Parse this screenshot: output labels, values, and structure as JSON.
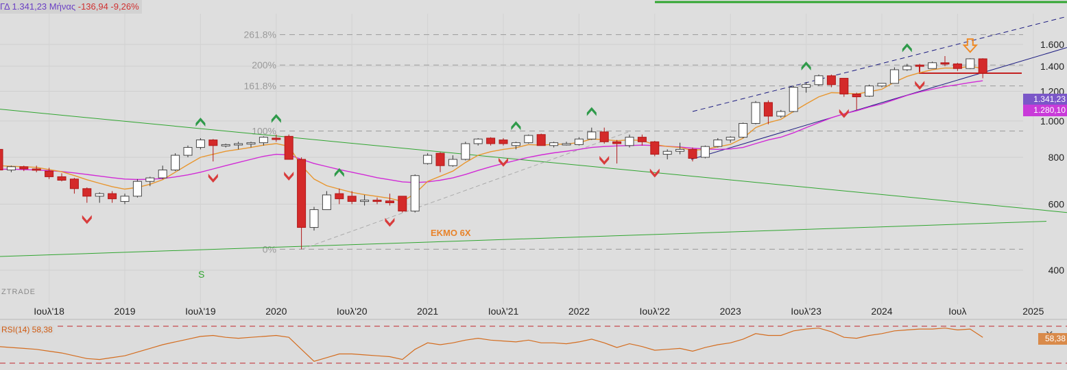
{
  "header": {
    "symbol": "ΓΔ 1.341,23 Μήνας",
    "change": "-136,94 -9,26%"
  },
  "watermark": "ZTRADE",
  "annotations": {
    "ema_label": "ΕΚΜΟ 6Χ",
    "s_marker": "S"
  },
  "price_tags": {
    "last": "1.341,23",
    "ma": "1.280,10"
  },
  "rsi": {
    "label": "RSI(14)   58,38",
    "value_tag": "58,38",
    "close_icon": "✕"
  },
  "colors": {
    "up": "#ffffff",
    "down": "#d42a2a",
    "ema": "#e8962e",
    "sma": "#d12ad6",
    "trend_green": "#2fa52f",
    "channel_blue": "#1a1a80",
    "rsi": "#d46c1e",
    "last_tag": "#7a57c8",
    "ma_tag": "#c93ad9"
  },
  "chart_data": [
    {
      "type": "candlestick",
      "title": "ΓΔ — monthly",
      "y_scale": "log",
      "ylim": [
        360,
        1800
      ],
      "y_ticks": [
        "1.600",
        "1.400",
        "1.200",
        "1.000",
        "800",
        "600",
        "400"
      ],
      "y_tick_values": [
        1600,
        1400,
        1200,
        1000,
        800,
        600,
        400
      ],
      "x_ticks": [
        "Ιουλ'18",
        "2019",
        "Ιουλ'19",
        "2020",
        "Ιουλ'20",
        "2021",
        "Ιουλ'21",
        "2022",
        "Ιουλ'22",
        "2023",
        "Ιουλ'23",
        "2024",
        "Ιουλ",
        "2025"
      ],
      "x_tick_dates": [
        "2018-07",
        "2019-01",
        "2019-07",
        "2020-01",
        "2020-07",
        "2021-01",
        "2021-07",
        "2022-01",
        "2022-07",
        "2023-01",
        "2023-07",
        "2024-01",
        "2024-07",
        "2025-01"
      ],
      "first_month": "2018-01",
      "fib_levels": [
        {
          "label": "261.8%",
          "value": 1700
        },
        {
          "label": "200%",
          "value": 1410
        },
        {
          "label": "161.8%",
          "value": 1240
        },
        {
          "label": "100%",
          "value": 940
        },
        {
          "label": "0%",
          "value": 455
        }
      ],
      "candles": [
        [
          780,
          800,
          730,
          760
        ],
        [
          765,
          850,
          750,
          840
        ],
        [
          840,
          850,
          730,
          740
        ],
        [
          740,
          760,
          730,
          755
        ],
        [
          755,
          760,
          735,
          745
        ],
        [
          745,
          760,
          730,
          740
        ],
        [
          735,
          750,
          700,
          710
        ],
        [
          710,
          725,
          690,
          695
        ],
        [
          700,
          705,
          640,
          660
        ],
        [
          660,
          665,
          605,
          630
        ],
        [
          630,
          645,
          605,
          640
        ],
        [
          640,
          650,
          605,
          620
        ],
        [
          610,
          640,
          600,
          630
        ],
        [
          630,
          700,
          625,
          690
        ],
        [
          690,
          710,
          670,
          705
        ],
        [
          705,
          760,
          700,
          740
        ],
        [
          740,
          820,
          735,
          810
        ],
        [
          810,
          860,
          800,
          850
        ],
        [
          850,
          900,
          840,
          890
        ],
        [
          890,
          895,
          780,
          860
        ],
        [
          860,
          870,
          850,
          865
        ],
        [
          865,
          880,
          840,
          870
        ],
        [
          870,
          880,
          850,
          875
        ],
        [
          875,
          910,
          860,
          905
        ],
        [
          900,
          920,
          880,
          895
        ],
        [
          910,
          920,
          790,
          790
        ],
        [
          790,
          800,
          455,
          520
        ],
        [
          520,
          590,
          510,
          580
        ],
        [
          580,
          650,
          580,
          635
        ],
        [
          640,
          660,
          600,
          620
        ],
        [
          630,
          650,
          600,
          610
        ],
        [
          610,
          635,
          595,
          615
        ],
        [
          615,
          625,
          600,
          612
        ],
        [
          612,
          640,
          595,
          605
        ],
        [
          630,
          630,
          570,
          575
        ],
        [
          575,
          720,
          570,
          715
        ],
        [
          770,
          820,
          765,
          810
        ],
        [
          820,
          825,
          730,
          760
        ],
        [
          760,
          810,
          755,
          790
        ],
        [
          790,
          880,
          785,
          870
        ],
        [
          870,
          900,
          860,
          895
        ],
        [
          900,
          905,
          860,
          870
        ],
        [
          890,
          900,
          860,
          870
        ],
        [
          860,
          880,
          840,
          875
        ],
        [
          875,
          920,
          870,
          915
        ],
        [
          920,
          925,
          860,
          860
        ],
        [
          860,
          880,
          850,
          875
        ],
        [
          870,
          880,
          860,
          870
        ],
        [
          865,
          905,
          860,
          895
        ],
        [
          895,
          960,
          890,
          935
        ],
        [
          935,
          960,
          870,
          880
        ],
        [
          880,
          890,
          770,
          870
        ],
        [
          860,
          920,
          850,
          905
        ],
        [
          905,
          920,
          860,
          880
        ],
        [
          880,
          885,
          805,
          815
        ],
        [
          815,
          840,
          790,
          830
        ],
        [
          830,
          875,
          815,
          840
        ],
        [
          840,
          850,
          780,
          795
        ],
        [
          800,
          860,
          795,
          855
        ],
        [
          855,
          900,
          850,
          890
        ],
        [
          890,
          910,
          875,
          905
        ],
        [
          905,
          990,
          900,
          985
        ],
        [
          985,
          1130,
          980,
          1120
        ],
        [
          1120,
          1135,
          980,
          1030
        ],
        [
          1030,
          1070,
          1020,
          1060
        ],
        [
          1060,
          1240,
          1055,
          1230
        ],
        [
          1230,
          1270,
          1190,
          1250
        ],
        [
          1250,
          1330,
          1240,
          1320
        ],
        [
          1320,
          1330,
          1230,
          1250
        ],
        [
          1300,
          1300,
          1160,
          1180
        ],
        [
          1180,
          1190,
          1070,
          1160
        ],
        [
          1165,
          1250,
          1160,
          1240
        ],
        [
          1240,
          1260,
          1230,
          1260
        ],
        [
          1260,
          1390,
          1260,
          1370
        ],
        [
          1370,
          1420,
          1360,
          1400
        ],
        [
          1410,
          1420,
          1380,
          1400
        ],
        [
          1380,
          1440,
          1380,
          1430
        ],
        [
          1430,
          1490,
          1400,
          1420
        ],
        [
          1420,
          1430,
          1360,
          1380
        ],
        [
          1380,
          1470,
          1375,
          1465
        ],
        [
          1465,
          1470,
          1300,
          1341
        ]
      ],
      "ema6": [
        760,
        765,
        760,
        757,
        755,
        752,
        742,
        732,
        715,
        697,
        682,
        668,
        658,
        665,
        678,
        697,
        730,
        765,
        800,
        815,
        830,
        840,
        850,
        862,
        870,
        856,
        760,
        700,
        672,
        658,
        645,
        636,
        629,
        622,
        610,
        640,
        690,
        712,
        735,
        775,
        810,
        828,
        840,
        848,
        865,
        862,
        866,
        868,
        876,
        895,
        892,
        886,
        890,
        887,
        865,
        855,
        850,
        835,
        840,
        853,
        866,
        900,
        960,
        990,
        1010,
        1060,
        1110,
        1160,
        1190,
        1187,
        1180,
        1197,
        1215,
        1270,
        1315,
        1345,
        1370,
        1385,
        1383,
        1400,
        1380
      ],
      "sma": [
        740,
        742,
        743,
        744,
        742,
        740,
        737,
        733,
        727,
        720,
        713,
        706,
        700,
        698,
        699,
        702,
        709,
        718,
        730,
        745,
        760,
        775,
        790,
        805,
        815,
        812,
        790,
        770,
        756,
        742,
        730,
        718,
        706,
        697,
        688,
        685,
        688,
        695,
        705,
        720,
        738,
        755,
        770,
        785,
        800,
        812,
        822,
        830,
        840,
        850,
        855,
        858,
        860,
        862,
        860,
        856,
        852,
        846,
        842,
        840,
        842,
        850,
        870,
        890,
        905,
        930,
        960,
        990,
        1020,
        1045,
        1065,
        1090,
        1110,
        1140,
        1170,
        1195,
        1215,
        1235,
        1250,
        1266,
        1280
      ]
    },
    {
      "type": "line",
      "title": "RSI(14)",
      "ylim": [
        20,
        80
      ],
      "ref_lines": [
        70,
        30
      ],
      "values": [
        55,
        50,
        48,
        47,
        46,
        45,
        43,
        41,
        38,
        35,
        34,
        36,
        38,
        42,
        46,
        50,
        53,
        56,
        59,
        60,
        58,
        57,
        58,
        59,
        60,
        58,
        45,
        32,
        36,
        40,
        40,
        39,
        38,
        37,
        34,
        45,
        52,
        50,
        52,
        55,
        57,
        55,
        54,
        53,
        55,
        52,
        52,
        51,
        53,
        56,
        52,
        47,
        51,
        48,
        44,
        45,
        46,
        43,
        47,
        50,
        52,
        56,
        62,
        60,
        60,
        65,
        67,
        68,
        64,
        58,
        57,
        60,
        62,
        65,
        66,
        67,
        67,
        68,
        66,
        67,
        58
      ]
    }
  ]
}
